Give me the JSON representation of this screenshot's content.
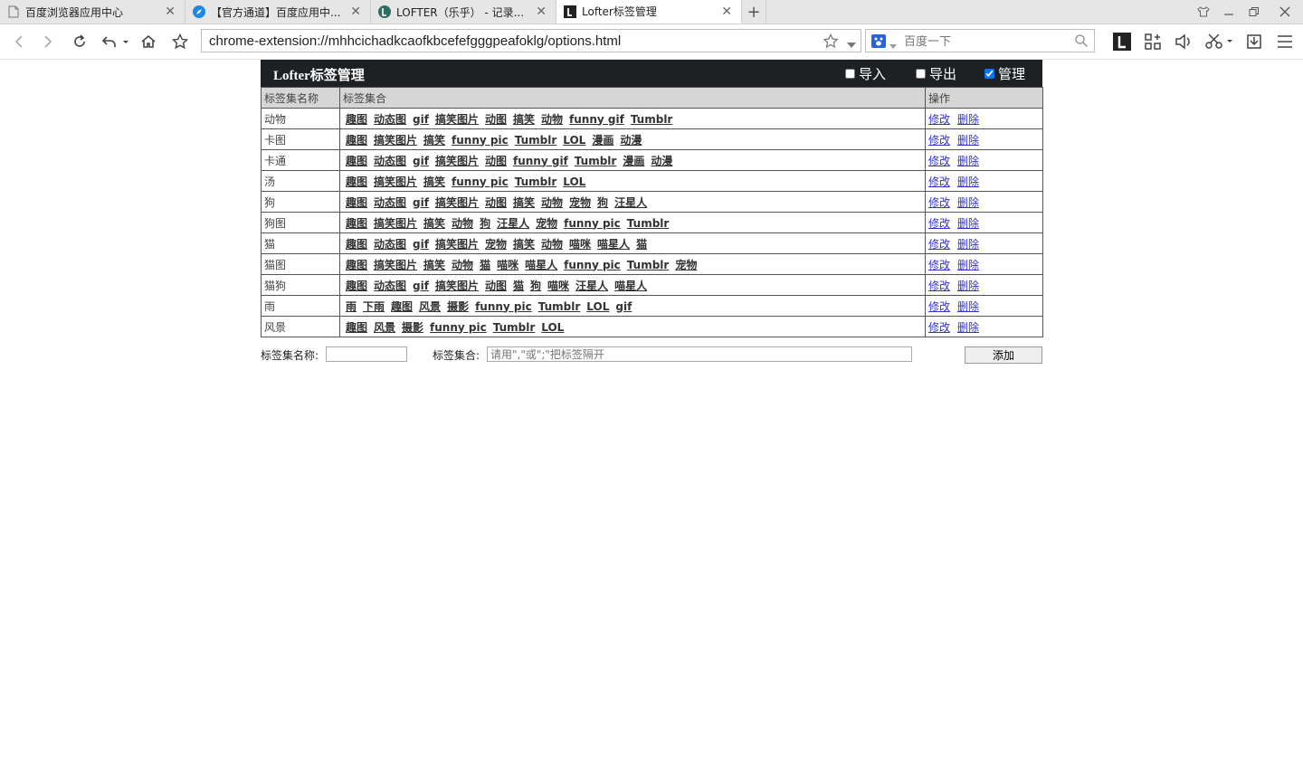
{
  "browser": {
    "tabs": [
      {
        "title": "百度浏览器应用中心",
        "icon": "page-icon",
        "active": false
      },
      {
        "title": "【官方通道】百度应用中...",
        "icon": "compass-icon",
        "active": false
      },
      {
        "title": "LOFTER（乐乎） - 记录...",
        "icon": "lofter-logo-icon",
        "active": false
      },
      {
        "title": "Lofter标签管理",
        "icon": "lofter-l-icon",
        "active": true
      }
    ],
    "url": "chrome-extension://mhhcichadkcaofkbcefefgggpeafoklg/options.html",
    "search_placeholder": "百度一下"
  },
  "header": {
    "title": "Lofter标签管理",
    "options": [
      {
        "label": "导入",
        "checked": false
      },
      {
        "label": "导出",
        "checked": false
      },
      {
        "label": "管理",
        "checked": true
      }
    ]
  },
  "table": {
    "columns": [
      "标签集名称",
      "标签集合",
      "操作"
    ],
    "actions": {
      "edit": "修改",
      "delete": "删除"
    },
    "rows": [
      {
        "name": "动物",
        "tags": [
          "趣图",
          "动态图",
          "gif",
          "搞笑图片",
          "动图",
          "搞笑",
          "动物",
          "funny gif",
          "Tumblr"
        ]
      },
      {
        "name": "卡图",
        "tags": [
          "趣图",
          "搞笑图片",
          "搞笑",
          "funny pic",
          "Tumblr",
          "LOL",
          "漫画",
          "动漫"
        ]
      },
      {
        "name": "卡通",
        "tags": [
          "趣图",
          "动态图",
          "gif",
          "搞笑图片",
          "动图",
          "funny gif",
          "Tumblr",
          "漫画",
          "动漫"
        ]
      },
      {
        "name": "汤",
        "tags": [
          "趣图",
          "搞笑图片",
          "搞笑",
          "funny pic",
          "Tumblr",
          "LOL"
        ]
      },
      {
        "name": "狗",
        "tags": [
          "趣图",
          "动态图",
          "gif",
          "搞笑图片",
          "动图",
          "搞笑",
          "动物",
          "宠物",
          "狗",
          "汪星人"
        ]
      },
      {
        "name": "狗图",
        "tags": [
          "趣图",
          "搞笑图片",
          "搞笑",
          "动物",
          "狗",
          "汪星人",
          "宠物",
          "funny pic",
          "Tumblr"
        ]
      },
      {
        "name": "猫",
        "tags": [
          "趣图",
          "动态图",
          "gif",
          "搞笑图片",
          "宠物",
          "搞笑",
          "动物",
          "喵咪",
          "喵星人",
          "猫"
        ]
      },
      {
        "name": "猫图",
        "tags": [
          "趣图",
          "搞笑图片",
          "搞笑",
          "动物",
          "猫",
          "喵咪",
          "喵星人",
          "funny pic",
          "Tumblr",
          "宠物"
        ]
      },
      {
        "name": "猫狗",
        "tags": [
          "趣图",
          "动态图",
          "gif",
          "搞笑图片",
          "动图",
          "猫",
          "狗",
          "喵咪",
          "汪星人",
          "喵星人"
        ]
      },
      {
        "name": "雨",
        "tags": [
          "雨",
          "下雨",
          "趣图",
          "风景",
          "摄影",
          "funny pic",
          "Tumblr",
          "LOL",
          "gif"
        ]
      },
      {
        "name": "风景",
        "tags": [
          "趣图",
          "风景",
          "摄影",
          "funny pic",
          "Tumblr",
          "LOL"
        ]
      }
    ]
  },
  "form": {
    "name_label": "标签集名称:",
    "name_value": "",
    "tags_label": "标签集合:",
    "tags_placeholder": "请用\",\"或\";\"把标签隔开",
    "add_button": "添加"
  }
}
